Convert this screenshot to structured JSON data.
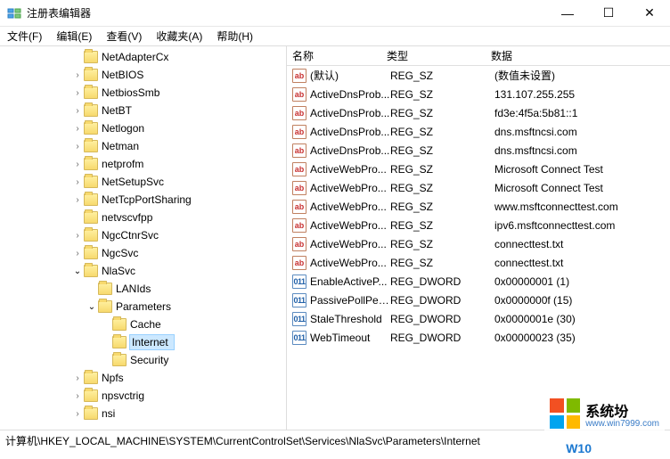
{
  "window": {
    "title": "注册表编辑器"
  },
  "window_controls": {
    "minimize": "—",
    "maximize": "☐",
    "close": "✕"
  },
  "menubar": {
    "file": "文件(F)",
    "edit": "编辑(E)",
    "view": "查看(V)",
    "favorites": "收藏夹(A)",
    "help": "帮助(H)"
  },
  "tree": {
    "items": [
      {
        "indent": 5,
        "expander": "",
        "label": "NetAdapterCx"
      },
      {
        "indent": 5,
        "expander": "›",
        "label": "NetBIOS"
      },
      {
        "indent": 5,
        "expander": "›",
        "label": "NetbiosSmb"
      },
      {
        "indent": 5,
        "expander": "›",
        "label": "NetBT"
      },
      {
        "indent": 5,
        "expander": "›",
        "label": "Netlogon"
      },
      {
        "indent": 5,
        "expander": "›",
        "label": "Netman"
      },
      {
        "indent": 5,
        "expander": "›",
        "label": "netprofm"
      },
      {
        "indent": 5,
        "expander": "›",
        "label": "NetSetupSvc"
      },
      {
        "indent": 5,
        "expander": "›",
        "label": "NetTcpPortSharing"
      },
      {
        "indent": 5,
        "expander": "",
        "label": "netvscvfpp"
      },
      {
        "indent": 5,
        "expander": "›",
        "label": "NgcCtnrSvc"
      },
      {
        "indent": 5,
        "expander": "›",
        "label": "NgcSvc"
      },
      {
        "indent": 5,
        "expander": "v",
        "label": "NlaSvc"
      },
      {
        "indent": 6,
        "expander": "",
        "label": "LANIds"
      },
      {
        "indent": 6,
        "expander": "v",
        "label": "Parameters"
      },
      {
        "indent": 7,
        "expander": "",
        "label": "Cache"
      },
      {
        "indent": 7,
        "expander": "",
        "label": "Internet",
        "selected": true
      },
      {
        "indent": 7,
        "expander": "",
        "label": "Security"
      },
      {
        "indent": 5,
        "expander": "›",
        "label": "Npfs"
      },
      {
        "indent": 5,
        "expander": "›",
        "label": "npsvctrig"
      },
      {
        "indent": 5,
        "expander": "›",
        "label": "nsi"
      }
    ]
  },
  "list": {
    "headers": {
      "name": "名称",
      "type": "类型",
      "data": "数据"
    },
    "rows": [
      {
        "icon": "str",
        "name": "(默认)",
        "type": "REG_SZ",
        "data": "(数值未设置)"
      },
      {
        "icon": "str",
        "name": "ActiveDnsProb...",
        "type": "REG_SZ",
        "data": "131.107.255.255"
      },
      {
        "icon": "str",
        "name": "ActiveDnsProb...",
        "type": "REG_SZ",
        "data": "fd3e:4f5a:5b81::1"
      },
      {
        "icon": "str",
        "name": "ActiveDnsProb...",
        "type": "REG_SZ",
        "data": "dns.msftncsi.com"
      },
      {
        "icon": "str",
        "name": "ActiveDnsProb...",
        "type": "REG_SZ",
        "data": "dns.msftncsi.com"
      },
      {
        "icon": "str",
        "name": "ActiveWebPro...",
        "type": "REG_SZ",
        "data": "Microsoft Connect Test"
      },
      {
        "icon": "str",
        "name": "ActiveWebPro...",
        "type": "REG_SZ",
        "data": "Microsoft Connect Test"
      },
      {
        "icon": "str",
        "name": "ActiveWebPro...",
        "type": "REG_SZ",
        "data": "www.msftconnecttest.com"
      },
      {
        "icon": "str",
        "name": "ActiveWebPro...",
        "type": "REG_SZ",
        "data": "ipv6.msftconnecttest.com"
      },
      {
        "icon": "str",
        "name": "ActiveWebPro...",
        "type": "REG_SZ",
        "data": "connecttest.txt"
      },
      {
        "icon": "str",
        "name": "ActiveWebPro...",
        "type": "REG_SZ",
        "data": "connecttest.txt"
      },
      {
        "icon": "dword",
        "name": "EnableActiveP...",
        "type": "REG_DWORD",
        "data": "0x00000001 (1)"
      },
      {
        "icon": "dword",
        "name": "PassivePollPeri...",
        "type": "REG_DWORD",
        "data": "0x0000000f (15)"
      },
      {
        "icon": "dword",
        "name": "StaleThreshold",
        "type": "REG_DWORD",
        "data": "0x0000001e (30)"
      },
      {
        "icon": "dword",
        "name": "WebTimeout",
        "type": "REG_DWORD",
        "data": "0x00000023 (35)"
      }
    ]
  },
  "statusbar": {
    "path": "计算机\\HKEY_LOCAL_MACHINE\\SYSTEM\\CurrentControlSet\\Services\\NlaSvc\\Parameters\\Internet"
  },
  "watermark": {
    "brand": "系统坋",
    "url": "www.win7999.com",
    "win": "W10"
  }
}
